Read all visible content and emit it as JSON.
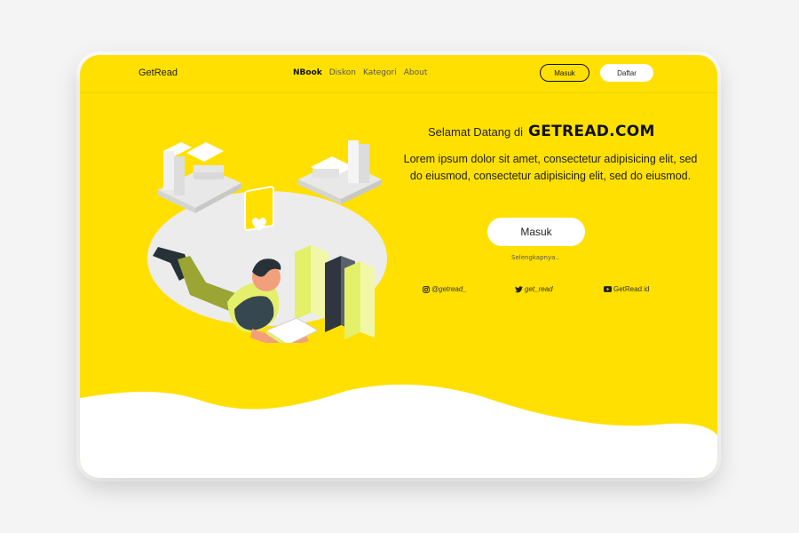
{
  "nav": {
    "brand": "GetRead",
    "items": [
      "NBook",
      "Diskon",
      "Kategori",
      "About"
    ],
    "login_label": "Masuk",
    "register_label": "Daftar"
  },
  "hero": {
    "greeting": "Selamat Datang di",
    "site_name": "GETREAD.COM",
    "description": "Lorem ipsum dolor sit amet, consectetur adipisicing elit, sed do eiusmod, consectetur adipisicing elit, sed do eiusmod.",
    "cta_label": "Masuk",
    "more_label": "Selengkapnya.."
  },
  "social": {
    "instagram": "@getread_",
    "twitter": "get_read",
    "youtube": "GetRead id"
  },
  "colors": {
    "accent": "#ffe000",
    "background": "#f4f4f5",
    "card": "#ffffff"
  }
}
